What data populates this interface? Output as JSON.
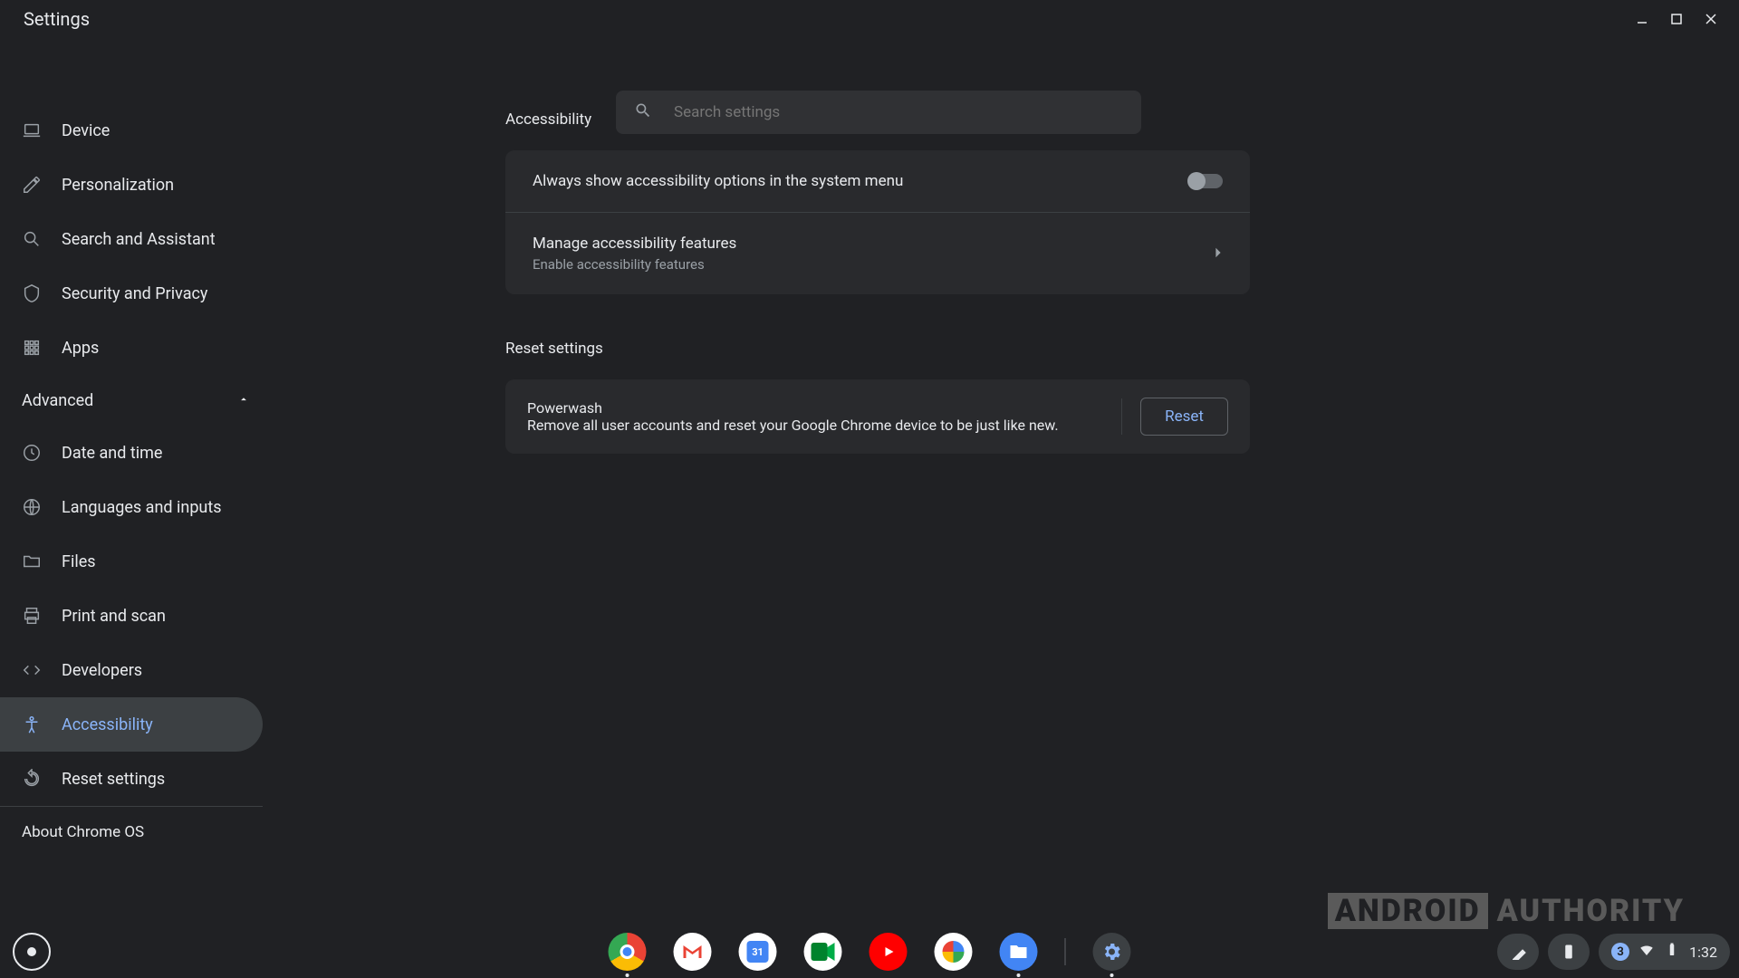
{
  "window": {
    "title": "Settings"
  },
  "search": {
    "placeholder": "Search settings"
  },
  "sidebar": {
    "items_top": [
      {
        "id": "device",
        "label": "Device"
      },
      {
        "id": "personalization",
        "label": "Personalization"
      },
      {
        "id": "search-assistant",
        "label": "Search and Assistant"
      },
      {
        "id": "security-privacy",
        "label": "Security and Privacy"
      },
      {
        "id": "apps",
        "label": "Apps"
      }
    ],
    "advanced_label": "Advanced",
    "items_adv": [
      {
        "id": "date-time",
        "label": "Date and time"
      },
      {
        "id": "languages",
        "label": "Languages and inputs"
      },
      {
        "id": "files",
        "label": "Files"
      },
      {
        "id": "print-scan",
        "label": "Print and scan"
      },
      {
        "id": "developers",
        "label": "Developers"
      },
      {
        "id": "accessibility",
        "label": "Accessibility"
      },
      {
        "id": "reset",
        "label": "Reset settings"
      }
    ],
    "about_label": "About Chrome OS"
  },
  "content": {
    "accessibility": {
      "title": "Accessibility",
      "always_show": {
        "label": "Always show accessibility options in the system menu",
        "enabled": false
      },
      "manage": {
        "primary": "Manage accessibility features",
        "secondary": "Enable accessibility features"
      }
    },
    "reset": {
      "title": "Reset settings",
      "powerwash": {
        "primary": "Powerwash",
        "secondary": "Remove all user accounts and reset your Google Chrome device to be just like new.",
        "button": "Reset"
      }
    }
  },
  "watermark": {
    "left": "ANDROID",
    "right": "AUTHORITY"
  },
  "tray": {
    "notif_count": "3",
    "time": "1:32"
  },
  "colors": {
    "accent": "#8ab4f8",
    "bg": "#202124",
    "card": "#292a2d"
  }
}
